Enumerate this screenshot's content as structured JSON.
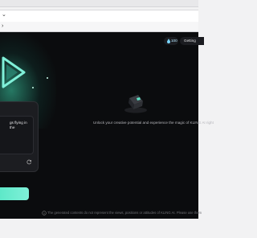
{
  "app": {
    "credits": "100",
    "getting_label": "Getting",
    "prompt_text": "gs flying in the",
    "empty_message": "Unlock your creative potential and experience the magic of KLING AI right",
    "footer_note": "The generated contents do not represent the views, positions or attitudes of KLING AI. Please use them",
    "accent_color": "#55e6c4",
    "icons": [
      "play-icon",
      "refresh-icon",
      "drop-icon",
      "cube-icon",
      "info-icon",
      "chevron-down-icon"
    ]
  }
}
